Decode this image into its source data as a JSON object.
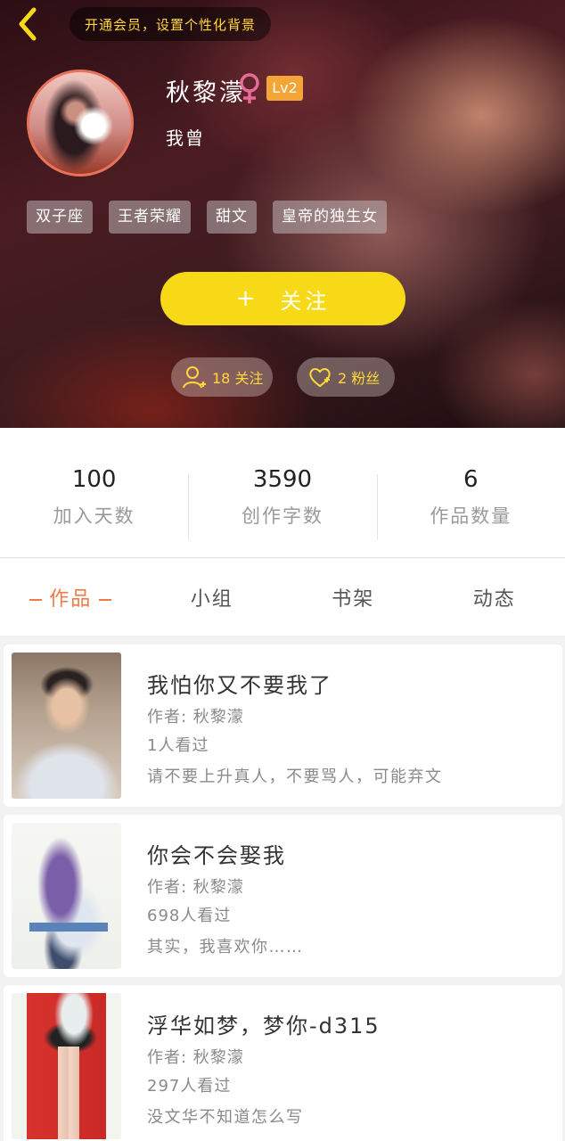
{
  "header": {
    "vip_banner": "开通会员，设置个性化背景",
    "username": "秋黎濛",
    "gender": "female",
    "level": "Lv2",
    "signature": "我曾",
    "tags": [
      "双子座",
      "王者荣耀",
      "甜文",
      "皇帝的独生女"
    ],
    "follow_button": "关注",
    "follow_plus": "+",
    "following_label": "18 关注",
    "fans_label": "2 粉丝",
    "colors": {
      "accent_yellow": "#f8d917",
      "level_orange": "#f3a637",
      "gender_pink": "#e86a9a"
    }
  },
  "stats": [
    {
      "value": "100",
      "label": "加入天数"
    },
    {
      "value": "3590",
      "label": "创作字数"
    },
    {
      "value": "6",
      "label": "作品数量"
    }
  ],
  "tabs": [
    {
      "label": "作品",
      "active": true
    },
    {
      "label": "小组",
      "active": false
    },
    {
      "label": "书架",
      "active": false
    },
    {
      "label": "动态",
      "active": false
    }
  ],
  "works": [
    {
      "title": "我怕你又不要我了",
      "author": "作者: 秋黎濛",
      "views": "1人看过",
      "desc": "请不要上升真人，不要骂人，可能弃文"
    },
    {
      "title": "你会不会娶我",
      "author": "作者: 秋黎濛",
      "views": "698人看过",
      "desc": "其实，我喜欢你……"
    },
    {
      "title": "浮华如梦，梦你-d315",
      "author": "作者: 秋黎濛",
      "views": "297人看过",
      "desc": "没文华不知道怎么写"
    }
  ],
  "icons": {
    "back": "chevron-left-icon",
    "gender": "female-icon",
    "following": "add-user-icon",
    "fans": "heart-plus-icon"
  }
}
